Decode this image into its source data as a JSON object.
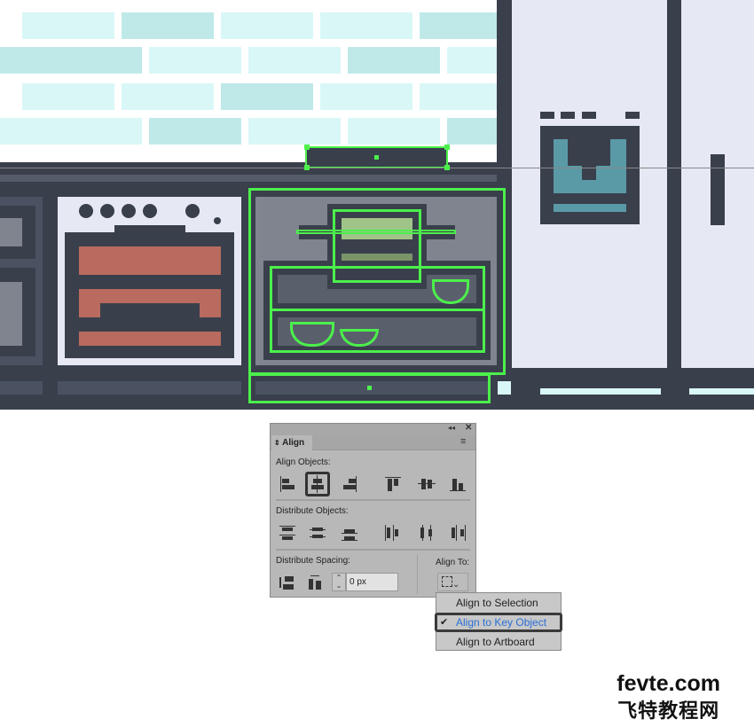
{
  "align_panel": {
    "tab_label": "Align",
    "collapse_icon": "double-chevron-left-icon",
    "close_icon": "close-icon",
    "menu_icon": "hamburger-icon",
    "align_objects_label": "Align Objects:",
    "distribute_objects_label": "Distribute Objects:",
    "distribute_spacing_label": "Distribute Spacing:",
    "align_to_label": "Align To:",
    "spacing_value": "0 px",
    "active_align_button": "horizontal-align-center"
  },
  "align_to_menu": {
    "items": [
      {
        "label": "Align to Selection",
        "checked": false
      },
      {
        "label": "Align to Key Object",
        "checked": true
      },
      {
        "label": "Align to Artboard",
        "checked": false
      }
    ],
    "check_mark": "✔"
  },
  "watermark": {
    "line1": "fevte.com",
    "line2": "飞特教程网"
  },
  "colors": {
    "selection": "#4cf04c",
    "dark": "#3a3f4c",
    "tile": "#d9f7f7",
    "oven_red": "#b86b5e",
    "accent_blue": "#2a6fd6"
  }
}
